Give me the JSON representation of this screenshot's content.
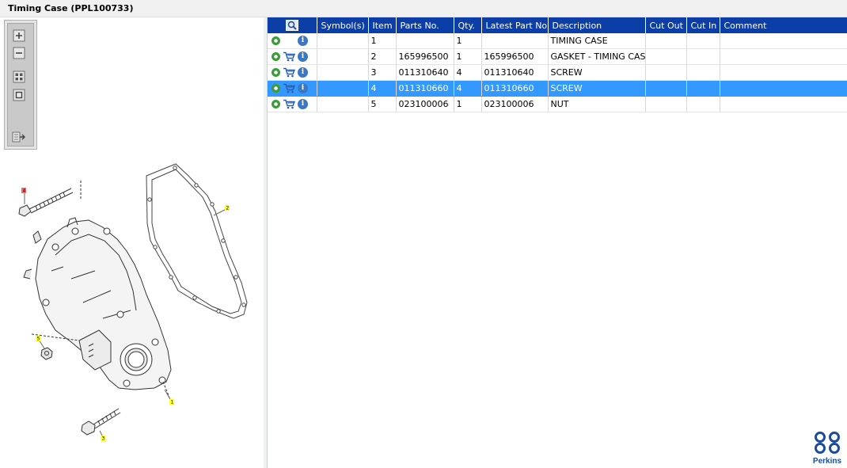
{
  "window": {
    "title": "Timing Case (PPL100733)"
  },
  "toolbar": {
    "zoom_in": "zoom-in",
    "zoom_out": "zoom-out",
    "fit_all": "fit-all",
    "fit_selection": "fit-selection",
    "export": "export"
  },
  "grid": {
    "columns": [
      "Symbol(s)",
      "Item",
      "Parts No.",
      "Qty.",
      "Latest Part No.",
      "Description",
      "Cut Out",
      "Cut In",
      "Comment"
    ],
    "rows": [
      {
        "item": "1",
        "parts_no": "",
        "qty": "1",
        "latest": "",
        "description": "TIMING CASE",
        "cut_out": "",
        "cut_in": "",
        "comment": "",
        "cart": false,
        "selected": false
      },
      {
        "item": "2",
        "parts_no": "165996500",
        "qty": "1",
        "latest": "165996500",
        "description": "GASKET - TIMING CASE COVER",
        "cut_out": "",
        "cut_in": "",
        "comment": "",
        "cart": true,
        "selected": false
      },
      {
        "item": "3",
        "parts_no": "011310640",
        "qty": "4",
        "latest": "011310640",
        "description": "SCREW",
        "cut_out": "",
        "cut_in": "",
        "comment": "",
        "cart": true,
        "selected": false
      },
      {
        "item": "4",
        "parts_no": "011310660",
        "qty": "4",
        "latest": "011310660",
        "description": "SCREW",
        "cut_out": "",
        "cut_in": "",
        "comment": "",
        "cart": true,
        "selected": true
      },
      {
        "item": "5",
        "parts_no": "023100006",
        "qty": "1",
        "latest": "023100006",
        "description": "NUT",
        "cut_out": "",
        "cut_in": "",
        "comment": "",
        "cart": true,
        "selected": false
      }
    ]
  },
  "callouts": [
    "1",
    "2",
    "3",
    "4",
    "5"
  ],
  "brand": {
    "name": "Perkins",
    "color": "#1b4c9b"
  },
  "colors": {
    "header": "#0c3ea8",
    "selection": "#3399ff",
    "callout": "#ffff33",
    "callout_selected": "#ff6666"
  }
}
